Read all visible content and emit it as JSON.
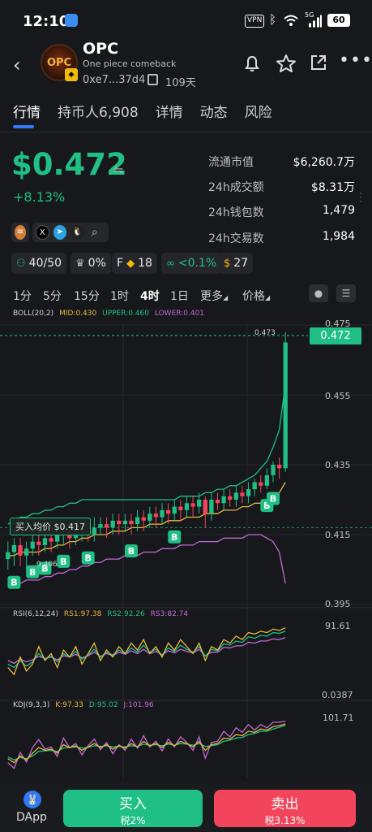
{
  "status_bar": {
    "time": "12:10",
    "vpn": "VPN",
    "network": "5G",
    "battery": "60"
  },
  "header": {
    "coin_name": "OPC",
    "coin_description": "One piece comeback",
    "address": "0xe7...37d4",
    "age": "109天"
  },
  "tabs": [
    {
      "label": "行情",
      "active": true
    },
    {
      "label": "持币人6,908"
    },
    {
      "label": "详情"
    },
    {
      "label": "动态"
    },
    {
      "label": "风险"
    }
  ],
  "price": {
    "value": "$0.472",
    "change": "+8.13%"
  },
  "stats": [
    {
      "label": "流通市值",
      "value": "$6,260.7万"
    },
    {
      "label": "24h成交额",
      "value": "$8.31万"
    },
    {
      "label": "24h钱包数",
      "value": "1,479"
    },
    {
      "label": "24h交易数",
      "value": "1,984"
    }
  ],
  "metrics": {
    "holders_ratio": "40/50",
    "chef_pct": "0%",
    "f_label": "F",
    "f_count": "18",
    "bundle_pct": "<0.1%",
    "fee_count": "27"
  },
  "intervals": [
    {
      "label": "1分"
    },
    {
      "label": "5分"
    },
    {
      "label": "15分"
    },
    {
      "label": "1时"
    },
    {
      "label": "4时",
      "active": true
    },
    {
      "label": "1日"
    },
    {
      "label": "更多"
    },
    {
      "label": "价格"
    }
  ],
  "indicators": {
    "boll": {
      "name": "BOLL(20,2)",
      "mid": "MID:0.430",
      "upper": "UPPER:0.460",
      "lower": "LOWER:0.401"
    },
    "rsi": {
      "name": "RSI(6,12,24)",
      "rs1": "RS1:97.38",
      "rs2": "RS2:92.26",
      "rs3": "RS3:82.74"
    },
    "kdj": {
      "name": "KDJ(9,3,3)",
      "k": "K:97.33",
      "d": "D:95.02",
      "j": "J:101.96"
    }
  },
  "colors": {
    "up": "#1fbf85",
    "down": "#f2445a",
    "upper": "#1fbf85",
    "mid": "#e6b83d",
    "lower": "#c06ad6",
    "accent": "#2e7cf6"
  },
  "chart_data": {
    "type": "candlestick",
    "interval": "4时",
    "ylim": [
      0.395,
      0.475
    ],
    "y_ticks": [
      "0.475",
      "0.455",
      "0.435",
      "0.415",
      "0.395"
    ],
    "current_price": "0.472",
    "high_label": "0.473",
    "low_label": "0.406",
    "avg_buy": {
      "label": "买入均价 $0.417",
      "value": 0.417
    },
    "candles": [
      [
        0.408,
        0.41,
        0.405,
        0.413
      ],
      [
        0.41,
        0.412,
        0.406,
        0.414
      ],
      [
        0.412,
        0.409,
        0.406,
        0.414
      ],
      [
        0.409,
        0.411,
        0.405,
        0.413
      ],
      [
        0.411,
        0.413,
        0.409,
        0.415
      ],
      [
        0.413,
        0.412,
        0.409,
        0.416
      ],
      [
        0.412,
        0.414,
        0.41,
        0.417
      ],
      [
        0.414,
        0.413,
        0.41,
        0.416
      ],
      [
        0.413,
        0.415,
        0.411,
        0.417
      ],
      [
        0.415,
        0.416,
        0.412,
        0.418
      ],
      [
        0.416,
        0.414,
        0.411,
        0.418
      ],
      [
        0.414,
        0.416,
        0.412,
        0.419
      ],
      [
        0.416,
        0.417,
        0.413,
        0.419
      ],
      [
        0.417,
        0.415,
        0.413,
        0.419
      ],
      [
        0.415,
        0.417,
        0.413,
        0.42
      ],
      [
        0.417,
        0.418,
        0.415,
        0.42
      ],
      [
        0.418,
        0.417,
        0.414,
        0.42
      ],
      [
        0.417,
        0.419,
        0.415,
        0.421
      ],
      [
        0.419,
        0.418,
        0.415,
        0.421
      ],
      [
        0.418,
        0.419,
        0.416,
        0.421
      ],
      [
        0.419,
        0.418,
        0.415,
        0.421
      ],
      [
        0.418,
        0.42,
        0.416,
        0.422
      ],
      [
        0.42,
        0.419,
        0.416,
        0.422
      ],
      [
        0.419,
        0.421,
        0.417,
        0.423
      ],
      [
        0.421,
        0.42,
        0.417,
        0.423
      ],
      [
        0.42,
        0.422,
        0.418,
        0.424
      ],
      [
        0.422,
        0.421,
        0.418,
        0.424
      ],
      [
        0.421,
        0.423,
        0.419,
        0.425
      ],
      [
        0.423,
        0.422,
        0.419,
        0.425
      ],
      [
        0.422,
        0.424,
        0.42,
        0.426
      ],
      [
        0.424,
        0.423,
        0.42,
        0.426
      ],
      [
        0.423,
        0.425,
        0.421,
        0.427
      ],
      [
        0.425,
        0.421,
        0.417,
        0.426
      ],
      [
        0.421,
        0.425,
        0.419,
        0.427
      ],
      [
        0.425,
        0.424,
        0.422,
        0.427
      ],
      [
        0.424,
        0.426,
        0.422,
        0.428
      ],
      [
        0.426,
        0.425,
        0.423,
        0.428
      ],
      [
        0.425,
        0.427,
        0.423,
        0.429
      ],
      [
        0.427,
        0.426,
        0.424,
        0.429
      ],
      [
        0.426,
        0.428,
        0.424,
        0.43
      ],
      [
        0.428,
        0.43,
        0.426,
        0.431
      ],
      [
        0.43,
        0.429,
        0.427,
        0.432
      ],
      [
        0.429,
        0.432,
        0.428,
        0.434
      ],
      [
        0.432,
        0.435,
        0.43,
        0.436
      ],
      [
        0.435,
        0.434,
        0.431,
        0.437
      ],
      [
        0.434,
        0.47,
        0.433,
        0.473
      ]
    ],
    "boll_upper": [
      0.418,
      0.419,
      0.42,
      0.42,
      0.421,
      0.421,
      0.422,
      0.422,
      0.423,
      0.423,
      0.424,
      0.424,
      0.425,
      0.425,
      0.425,
      0.425,
      0.425,
      0.425,
      0.425,
      0.425,
      0.425,
      0.425,
      0.425,
      0.425,
      0.425,
      0.425,
      0.425,
      0.425,
      0.426,
      0.426,
      0.426,
      0.426,
      0.427,
      0.427,
      0.428,
      0.428,
      0.429,
      0.429,
      0.43,
      0.431,
      0.432,
      0.434,
      0.436,
      0.44,
      0.445,
      0.458
    ],
    "boll_mid": [
      0.409,
      0.409,
      0.41,
      0.41,
      0.41,
      0.41,
      0.411,
      0.411,
      0.412,
      0.412,
      0.413,
      0.413,
      0.414,
      0.414,
      0.415,
      0.415,
      0.415,
      0.416,
      0.416,
      0.416,
      0.417,
      0.417,
      0.417,
      0.418,
      0.418,
      0.418,
      0.419,
      0.419,
      0.419,
      0.42,
      0.42,
      0.42,
      0.421,
      0.421,
      0.421,
      0.422,
      0.422,
      0.422,
      0.423,
      0.423,
      0.424,
      0.424,
      0.425,
      0.426,
      0.427,
      0.43
    ],
    "boll_lower": [
      0.401,
      0.401,
      0.401,
      0.402,
      0.402,
      0.402,
      0.403,
      0.403,
      0.404,
      0.404,
      0.405,
      0.405,
      0.406,
      0.406,
      0.407,
      0.407,
      0.408,
      0.408,
      0.408,
      0.409,
      0.409,
      0.409,
      0.41,
      0.41,
      0.41,
      0.411,
      0.411,
      0.411,
      0.412,
      0.412,
      0.412,
      0.413,
      0.413,
      0.413,
      0.413,
      0.414,
      0.414,
      0.414,
      0.414,
      0.415,
      0.415,
      0.415,
      0.414,
      0.413,
      0.41,
      0.401
    ],
    "buy_markers": [
      1,
      4,
      6,
      9,
      13,
      20,
      27,
      42,
      43
    ],
    "rsi": {
      "ylim": [
        0,
        100
      ],
      "y_ticks": [
        "91.61",
        "0.0387"
      ],
      "rs1": [
        40,
        30,
        55,
        35,
        45,
        70,
        50,
        60,
        40,
        65,
        55,
        70,
        45,
        60,
        75,
        50,
        65,
        55,
        70,
        60,
        75,
        65,
        80,
        60,
        70,
        55,
        75,
        65,
        80,
        70,
        60,
        75,
        50,
        70,
        65,
        80,
        75,
        85,
        80,
        90,
        88,
        92,
        90,
        95,
        93,
        97
      ],
      "rs2": [
        45,
        40,
        50,
        42,
        48,
        60,
        52,
        56,
        48,
        60,
        55,
        63,
        52,
        58,
        66,
        55,
        62,
        58,
        65,
        60,
        68,
        62,
        72,
        62,
        66,
        58,
        68,
        63,
        72,
        66,
        62,
        70,
        56,
        66,
        64,
        74,
        72,
        78,
        76,
        84,
        82,
        86,
        85,
        90,
        89,
        92
      ],
      "rs3": [
        50,
        46,
        52,
        48,
        51,
        56,
        53,
        55,
        51,
        57,
        55,
        59,
        54,
        57,
        62,
        56,
        60,
        57,
        62,
        59,
        64,
        60,
        66,
        60,
        63,
        58,
        64,
        61,
        66,
        63,
        61,
        66,
        57,
        62,
        62,
        69,
        68,
        71,
        71,
        76,
        75,
        78,
        78,
        81,
        80,
        83
      ]
    },
    "kdj": {
      "ylim": [
        0,
        110
      ],
      "y_ticks": [
        "101.71"
      ],
      "k": [
        35,
        28,
        40,
        33,
        45,
        55,
        50,
        52,
        45,
        60,
        55,
        58,
        50,
        56,
        62,
        55,
        60,
        52,
        58,
        54,
        62,
        56,
        66,
        58,
        62,
        55,
        64,
        58,
        66,
        62,
        56,
        66,
        50,
        60,
        62,
        72,
        70,
        78,
        76,
        84,
        82,
        88,
        86,
        92,
        94,
        97
      ],
      "d": [
        38,
        33,
        37,
        35,
        40,
        48,
        49,
        50,
        48,
        54,
        55,
        56,
        54,
        55,
        58,
        57,
        58,
        56,
        57,
        56,
        58,
        57,
        61,
        59,
        60,
        58,
        61,
        59,
        62,
        61,
        59,
        62,
        57,
        58,
        60,
        66,
        68,
        72,
        73,
        78,
        80,
        84,
        84,
        88,
        91,
        95
      ],
      "j": [
        28,
        18,
        46,
        29,
        55,
        69,
        52,
        56,
        39,
        72,
        55,
        62,
        42,
        58,
        70,
        51,
        64,
        44,
        60,
        50,
        70,
        54,
        76,
        56,
        66,
        49,
        70,
        56,
        74,
        64,
        50,
        74,
        36,
        64,
        66,
        84,
        74,
        90,
        82,
        96,
        86,
        96,
        90,
        100,
        100,
        101.96
      ]
    }
  },
  "bottom": {
    "dapp": "DApp",
    "buy": "买入",
    "buy_tax": "税2%",
    "sell": "卖出",
    "sell_tax": "税3.13%"
  }
}
